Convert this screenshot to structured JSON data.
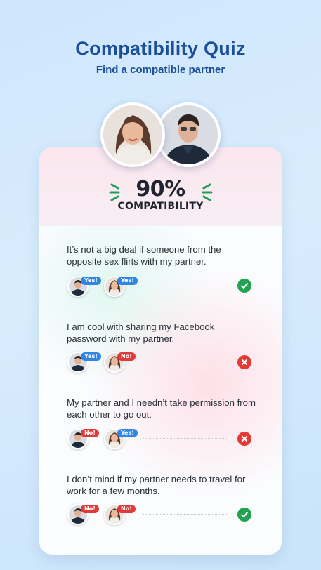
{
  "header": {
    "title": "Compatibility Quiz",
    "subtitle": "Find a compatible partner"
  },
  "score": {
    "percent": "90%",
    "label": "COMPATIBILITY"
  },
  "colors": {
    "title": "#1b4f9c",
    "yes_badge": "#2f86e6",
    "no_badge": "#e23a3a",
    "match": "#22a351",
    "mismatch": "#e53935"
  },
  "questions": [
    {
      "text": "It’s not a big deal if someone from the opposite sex flirts with my partner.",
      "male_answer": "Yes!",
      "female_answer": "Yes!",
      "result": "match",
      "result_icon": "check-icon"
    },
    {
      "text": "I am cool with sharing my Facebook password with my partner.",
      "male_answer": "Yes!",
      "female_answer": "No!",
      "result": "mismatch",
      "result_icon": "cross-icon"
    },
    {
      "text": "My partner and I needn’t take permission from each other to go out.",
      "male_answer": "No!",
      "female_answer": "Yes!",
      "result": "mismatch",
      "result_icon": "cross-icon"
    },
    {
      "text": "I don’t mind if my partner needs to travel for work for a few months.",
      "male_answer": "No!",
      "female_answer": "No!",
      "result": "match",
      "result_icon": "check-icon"
    }
  ]
}
